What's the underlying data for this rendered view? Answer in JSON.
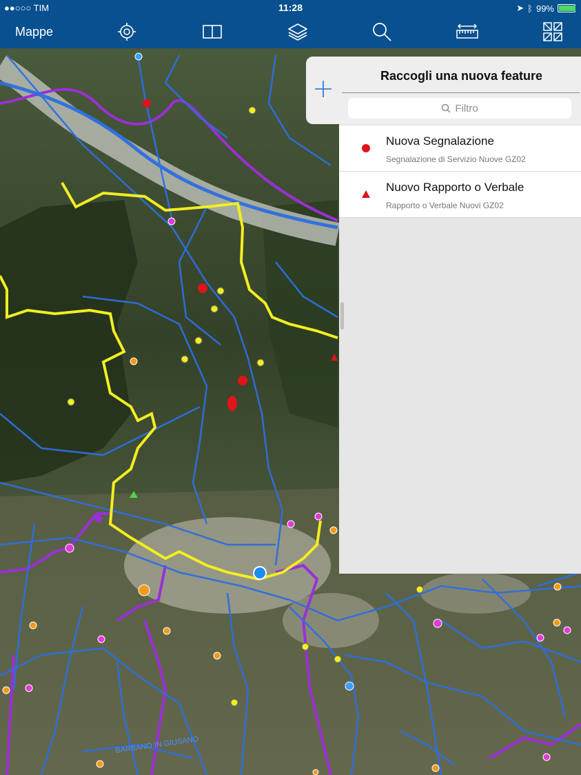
{
  "status_bar": {
    "carrier": "●●○○○ TIM",
    "time": "11:28",
    "battery": "99%",
    "battery_level": 0.99
  },
  "toolbar": {
    "title": "Mappe",
    "icons": [
      "locate-icon",
      "book-icon",
      "layers-icon",
      "search-icon",
      "measure-icon",
      "map-tools-icon"
    ]
  },
  "panel": {
    "title": "Raccogli una nuova feature",
    "filter_placeholder": "Filtro",
    "items": [
      {
        "title": "Nuova Segnalazione",
        "subtitle": "Segnalazione di Servizio Nuove GZ02",
        "symbol": "circle",
        "color": "#e0141b"
      },
      {
        "title": "Nuovo Rapporto o Verbale",
        "subtitle": "Rapporto o Verbale Nuovi GZ02",
        "symbol": "triangle",
        "color": "#e0141b"
      }
    ]
  },
  "map": {
    "labels": [
      "BARBANO IN GIUSANO"
    ],
    "colors": {
      "network": "#2c6fe0",
      "boundary": "#f2ee22",
      "purple": "#9b2fd6",
      "feature": "#e0141b"
    }
  }
}
